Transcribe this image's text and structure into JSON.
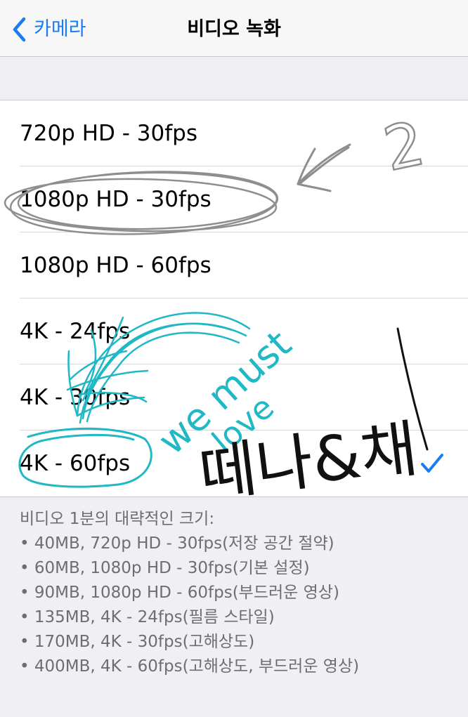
{
  "navbar": {
    "back_label": "카메라",
    "title": "비디오 녹화"
  },
  "options": [
    {
      "label": "720p HD - 30fps",
      "selected": false
    },
    {
      "label": "1080p HD - 30fps",
      "selected": false
    },
    {
      "label": "1080p HD - 60fps",
      "selected": false
    },
    {
      "label": "4K - 24fps",
      "selected": false
    },
    {
      "label": "4K - 30fps",
      "selected": false
    },
    {
      "label": "4K - 60fps",
      "selected": true
    }
  ],
  "footer": {
    "heading": "비디오 1분의 대략적인 크기:",
    "items": [
      "• 40MB, 720p HD - 30fps(저장 공간 절약)",
      "• 60MB, 1080p HD - 30fps(기본 설정)",
      "• 90MB, 1080p HD - 60fps(부드러운 영상)",
      "• 135MB, 4K - 24fps(필름 스타일)",
      "• 170MB, 4K - 30fps(고해상도)",
      "• 400MB, 4K - 60fps(고해상도, 부드러운 영상)"
    ]
  },
  "annotations": {
    "gray_number": "2",
    "cyan_text_1": "we must",
    "cyan_text_2": "love",
    "black_text": "떼나&채"
  },
  "colors": {
    "accent": "#1a7cf5",
    "navbar_bg": "#f7f7f8",
    "page_bg": "#efeff4",
    "footer_text": "#6d6d72",
    "ink_gray": "#8e8e8e",
    "ink_cyan": "#1fb8c4",
    "ink_black": "#111111"
  },
  "icons": {
    "back": "chevron-left-icon",
    "selected": "checkmark-icon"
  }
}
